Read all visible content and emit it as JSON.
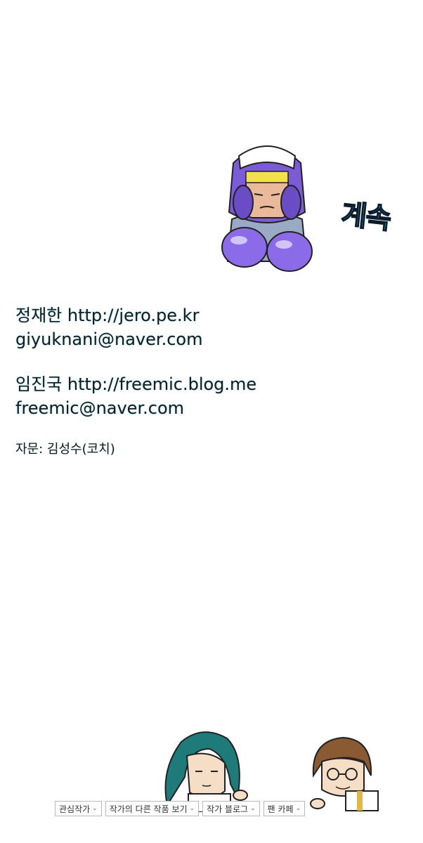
{
  "continued_text": "계속",
  "credits": {
    "author1_line": "정재한 http://jero.pe.kr",
    "author1_email": "giyuknani@naver.com",
    "author2_line": "임진국 http://freemic.blog.me",
    "author2_email": "freemic@naver.com",
    "advisor": "자문: 김성수(코치)"
  },
  "buttons": {
    "favorite_author": "관심작가",
    "other_works": "작가의 다른 작품 보기",
    "author_blog": "작가 블로그",
    "fan_cafe": "팬 카페"
  },
  "icons": {
    "dropdown": "chevron-down-icon"
  },
  "colors": {
    "accent_cyan": "#27b3e6",
    "glove_purple": "#7b5cd6",
    "button_border": "#b8b8b8"
  }
}
